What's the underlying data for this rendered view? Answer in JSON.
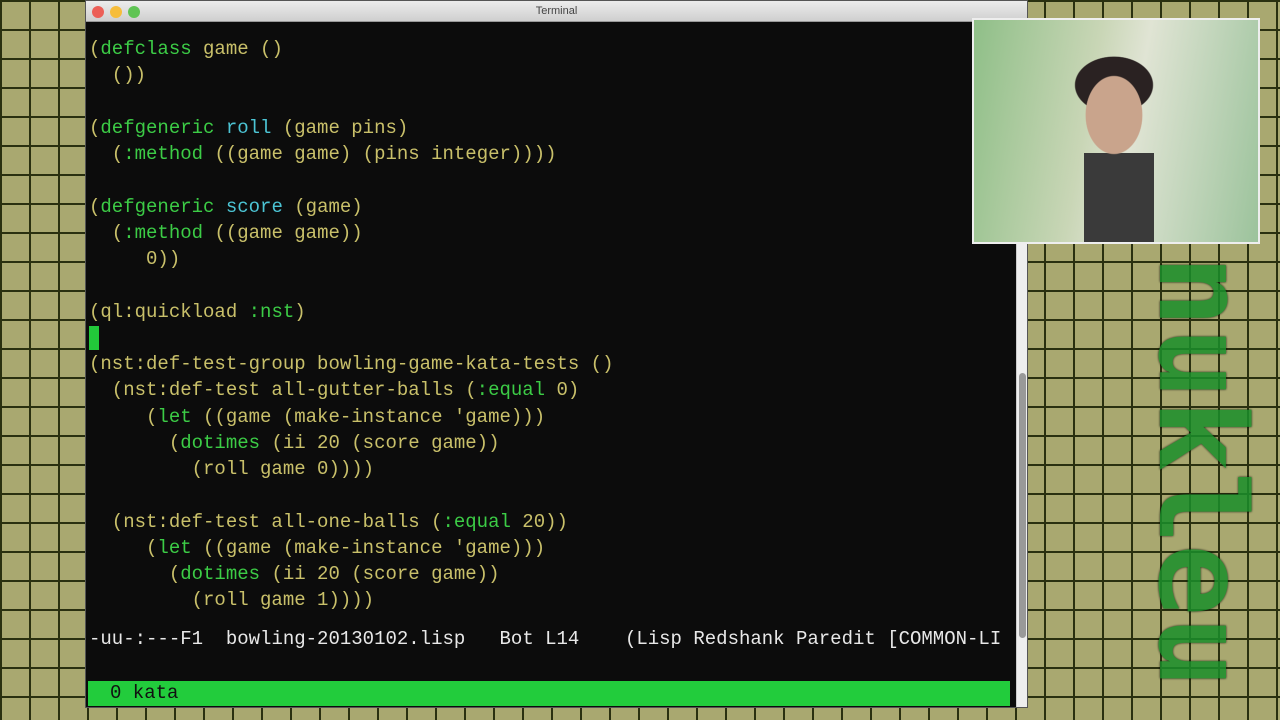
{
  "window": {
    "title": "Terminal"
  },
  "editor": {
    "lines": [
      [
        [
          "(",
          "t"
        ],
        [
          "defclass",
          "k"
        ],
        [
          " game ()",
          "t"
        ]
      ],
      [
        [
          "  ())",
          "t"
        ]
      ],
      [],
      [
        [
          "(",
          "t"
        ],
        [
          "defgeneric",
          "k"
        ],
        [
          " ",
          "t"
        ],
        [
          "roll",
          "f"
        ],
        [
          " (game pins)",
          "t"
        ]
      ],
      [
        [
          "  (",
          "t"
        ],
        [
          ":method",
          "k"
        ],
        [
          " ((game game) (pins integer))))",
          "t"
        ]
      ],
      [],
      [
        [
          "(",
          "t"
        ],
        [
          "defgeneric",
          "k"
        ],
        [
          " ",
          "t"
        ],
        [
          "score",
          "f"
        ],
        [
          " (game)",
          "t"
        ]
      ],
      [
        [
          "  (",
          "t"
        ],
        [
          ":method",
          "k"
        ],
        [
          " ((game game))",
          "t"
        ]
      ],
      [
        [
          "     0))",
          "t"
        ]
      ],
      [],
      [
        [
          "(ql:quickload ",
          "t"
        ],
        [
          ":nst",
          "k"
        ],
        [
          ")",
          "t"
        ]
      ],
      [
        [
          "",
          "cursor"
        ]
      ],
      [
        [
          "(nst:def-test-group bowling-game-kata-tests ()",
          "t"
        ]
      ],
      [
        [
          "  (nst:def-test all-gutter-balls (",
          "t"
        ],
        [
          ":equal",
          "k"
        ],
        [
          " 0)",
          "t"
        ]
      ],
      [
        [
          "     (",
          "t"
        ],
        [
          "let",
          "k"
        ],
        [
          " ((game (make-instance 'game)))",
          "t"
        ]
      ],
      [
        [
          "       (",
          "t"
        ],
        [
          "dotimes",
          "k"
        ],
        [
          " (ii 20 (score game))",
          "t"
        ]
      ],
      [
        [
          "         (roll game 0))))",
          "t"
        ]
      ],
      [],
      [
        [
          "  (nst:def-test all-one-balls (",
          "t"
        ],
        [
          ":equal",
          "k"
        ],
        [
          " 20))",
          "t"
        ]
      ],
      [
        [
          "     (",
          "t"
        ],
        [
          "let",
          "k"
        ],
        [
          " ((game (make-instance 'game)))",
          "t"
        ]
      ],
      [
        [
          "       (",
          "t"
        ],
        [
          "dotimes",
          "k"
        ],
        [
          " (ii 20 (score game))",
          "t"
        ]
      ],
      [
        [
          "         (roll game 1))))",
          "t"
        ]
      ]
    ]
  },
  "modeline": {
    "status": "-uu-:---F1",
    "file": "bowling-20130102.lisp",
    "position": "Bot L14",
    "modes": "(Lisp Redshank Paredit [COMMON-LI"
  },
  "tmux": {
    "label": "0 kata"
  },
  "logo": {
    "text": "nukleu"
  },
  "colors": {
    "keyword": "#3ccc46",
    "function": "#4cc4d4",
    "text": "#c9c06a",
    "statusbar": "#22cc3c"
  }
}
